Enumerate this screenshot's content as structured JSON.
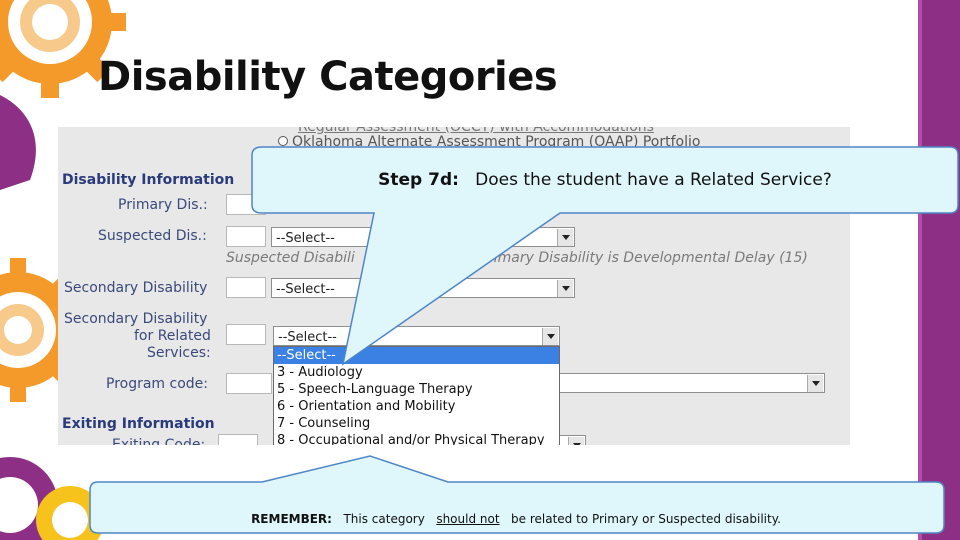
{
  "slide": {
    "title": "Disability Categories"
  },
  "form": {
    "assessment_line_1": "Regular Assessment (OCCT) with Accommodations",
    "assessment_option": "Oklahoma Alternate Assessment Program (OAAP) Portfolio",
    "disability_header": "Disability Information",
    "primary_label": "Primary Dis.:",
    "suspected_label": "Suspected Dis.:",
    "suspected_select": "--Select--",
    "suspected_note_left": "Suspected Disabili",
    "suspected_note_right": "rimary Disability is Developmental Delay (15)",
    "secondary_label": "Secondary Disability",
    "secondary_select": "--Select--",
    "secondary_related_label_1": "Secondary Disability",
    "secondary_related_label_2": "for Related",
    "secondary_related_label_3": "Services:",
    "secondary_related_select": "--Select--",
    "program_code_label": "Program code:",
    "exiting_header": "Exiting Information",
    "exiting_code_label": "Exiting Code:"
  },
  "dropdown": {
    "options": [
      "--Select--",
      "3 - Audiology",
      "5 - Speech-Language Therapy",
      "6 - Orientation and Mobility",
      "7 - Counseling",
      "8 - Occupational and/or Physical Therapy"
    ],
    "highlighted_index": 0
  },
  "callouts": {
    "step_label": "Step 7d:",
    "step_text": "Does the student have a Related Service?",
    "remember_label": "REMEMBER:",
    "remember_before": "This category",
    "remember_underlined": "should not",
    "remember_after": "be related to Primary or Suspected disability."
  },
  "colors": {
    "brand_orange": "#f39a2b",
    "brand_purple": "#8e2f86",
    "callout_fill": "#dff7fb",
    "callout_border": "#4f86c6",
    "dropdown_highlight": "#3b80e3"
  }
}
